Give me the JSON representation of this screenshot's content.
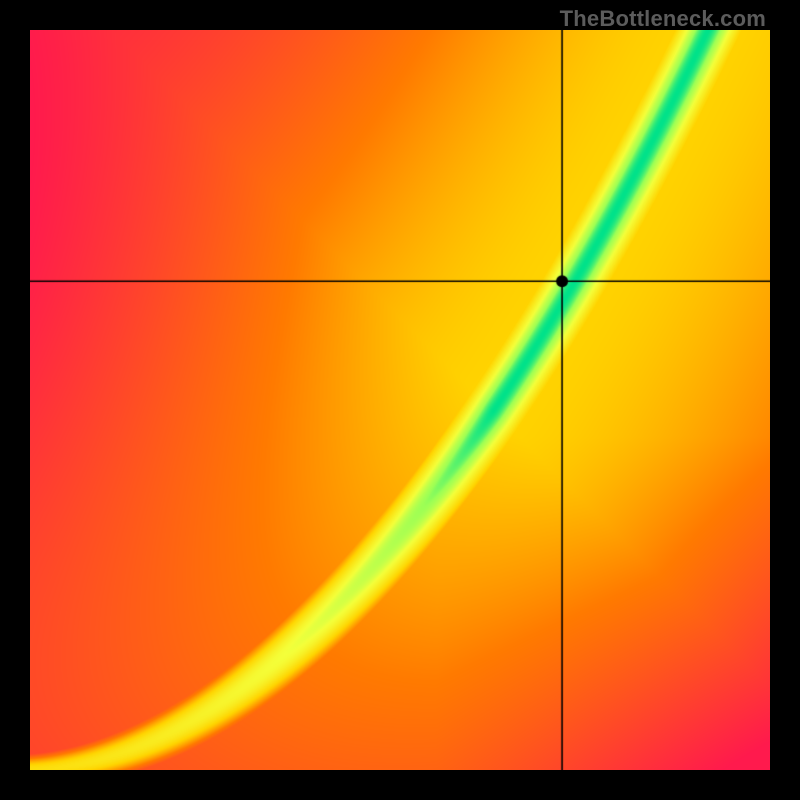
{
  "watermark": "TheBottleneck.com",
  "chart_data": {
    "type": "heatmap",
    "title": "",
    "xlabel": "",
    "ylabel": "",
    "xlim": [
      0,
      1
    ],
    "ylim": [
      0,
      1
    ],
    "grid": false,
    "legend": "none",
    "marker": {
      "x": 0.72,
      "y": 0.66
    },
    "crosshair": {
      "x": 0.72,
      "y": 0.66
    },
    "optimal_curve_note": "green ridge follows y ≈ x^2 bulging upward; values elsewhere graded through yellow/orange to red with distance",
    "color_scale": [
      {
        "value": 0.0,
        "color": "#ff1a4d"
      },
      {
        "value": 0.35,
        "color": "#ff7a00"
      },
      {
        "value": 0.55,
        "color": "#ffd400"
      },
      {
        "value": 0.78,
        "color": "#f4ff3a"
      },
      {
        "value": 0.92,
        "color": "#9dff55"
      },
      {
        "value": 1.0,
        "color": "#00e28a"
      }
    ],
    "ridge_width": 0.055,
    "ridge_power": 1.9
  }
}
